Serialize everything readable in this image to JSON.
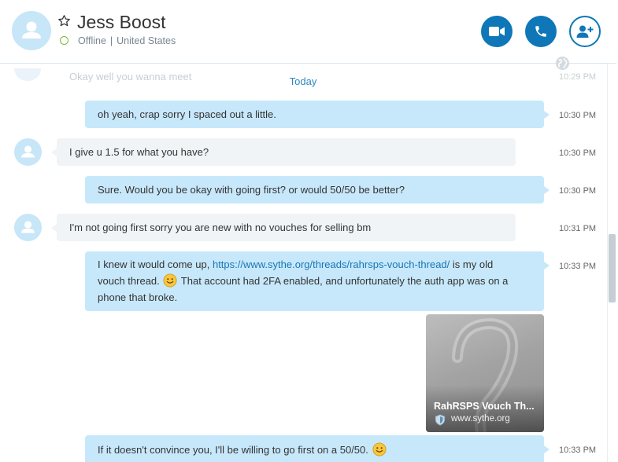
{
  "header": {
    "contact_name": "Jess Boost",
    "status": "Offline",
    "separator": "|",
    "location": "United States",
    "icons": {
      "avatar": "person-icon",
      "favorite": "star-outline-icon",
      "video": "video-camera-icon",
      "call": "phone-icon",
      "add_people": "add-person-icon",
      "translator": "globe-icon"
    },
    "colors": {
      "accent": "#0f77b8",
      "status_offline": "#7ab938",
      "outgoing_bubble": "#c7e8fb",
      "incoming_bubble": "#f1f4f6"
    }
  },
  "chat": {
    "partial_top_message": "Okay well you wanna meet",
    "partial_top_time": "10:29 PM",
    "day_separator": "Today",
    "messages": [
      {
        "direction": "out",
        "text": "oh yeah, crap sorry I spaced out a little.",
        "time": "10:30 PM"
      },
      {
        "direction": "in",
        "text": "I give u 1.5 for what you have?",
        "time": "10:30 PM"
      },
      {
        "direction": "out",
        "text": "Sure. Would you be okay with going first? or would 50/50 be better?",
        "time": "10:30 PM"
      },
      {
        "direction": "in",
        "text": "I'm not going first sorry you are new with no vouches for selling bm",
        "time": "10:31 PM"
      },
      {
        "direction": "out",
        "time": "10:33 PM",
        "text_before_link": "I knew it would come up, ",
        "link": "https://www.sythe.org/threads/rahrsps-vouch-thread/",
        "text_after_link": " is my old",
        "line2_before_emoji": "vouch thread.",
        "line2_after_emoji": "That account had 2FA enabled, and unfortunately the auth app was on a",
        "line3": "phone that broke."
      },
      {
        "direction": "out",
        "time": "10:33 PM",
        "text": "If it doesn't convince you, I'll be willing to go first on a 50/50."
      }
    ],
    "link_preview": {
      "title": "RahRSPS Vouch Th...",
      "domain": "www.sythe.org",
      "icon": "shield-icon"
    }
  }
}
